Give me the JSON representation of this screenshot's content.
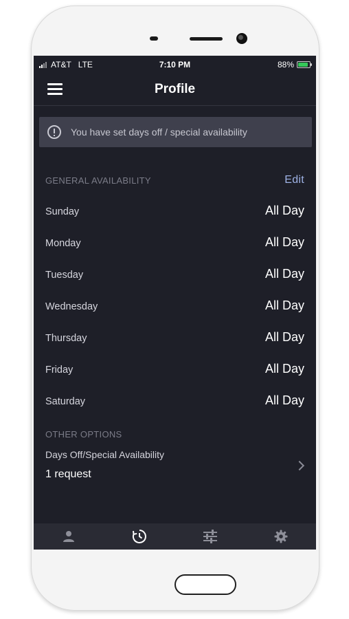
{
  "status_bar": {
    "carrier": "AT&T",
    "network": "LTE",
    "time": "7:10 PM",
    "battery": "88%",
    "battery_level": 0.88
  },
  "header": {
    "title": "Profile"
  },
  "banner": {
    "message": "You have set days off / special availability",
    "icon": "info-icon"
  },
  "general_availability": {
    "heading": "GENERAL AVAILABILITY",
    "edit_label": "Edit",
    "days": [
      {
        "day": "Sunday",
        "value": "All Day"
      },
      {
        "day": "Monday",
        "value": "All Day"
      },
      {
        "day": "Tuesday",
        "value": "All Day"
      },
      {
        "day": "Wednesday",
        "value": "All Day"
      },
      {
        "day": "Thursday",
        "value": "All Day"
      },
      {
        "day": "Friday",
        "value": "All Day"
      },
      {
        "day": "Saturday",
        "value": "All Day"
      }
    ]
  },
  "other_options": {
    "heading": "OTHER OPTIONS",
    "item_label": "Days Off/Special Availability",
    "item_value": "1 request"
  },
  "tabbar": {
    "tabs": [
      {
        "icon": "person-icon",
        "active": false
      },
      {
        "icon": "clock-icon",
        "active": true
      },
      {
        "icon": "sliders-icon",
        "active": false
      },
      {
        "icon": "gear-icon",
        "active": false
      }
    ]
  },
  "colors": {
    "background": "#1e1f28",
    "banner": "#3f404d",
    "accent_link": "#9fb3e6",
    "battery_green": "#35c759"
  }
}
